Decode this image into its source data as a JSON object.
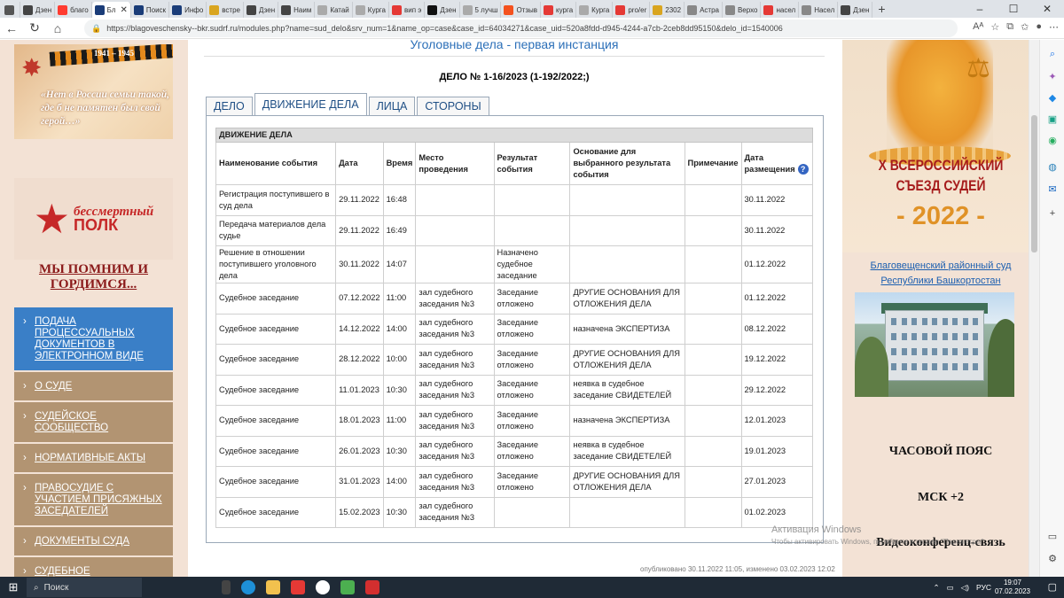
{
  "browser": {
    "tabs": [
      {
        "label": "",
        "color": "#555"
      },
      {
        "label": "Дзен",
        "color": "#444"
      },
      {
        "label": "благо",
        "color": "#ff3b30"
      },
      {
        "label": "Бл",
        "color": "#1a3c78",
        "active": true
      },
      {
        "label": "Поиск",
        "color": "#1a3c78"
      },
      {
        "label": "Инфо",
        "color": "#1a3c78"
      },
      {
        "label": "встре",
        "color": "#d9a520"
      },
      {
        "label": "Дзен",
        "color": "#444"
      },
      {
        "label": "Наим",
        "color": "#444"
      },
      {
        "label": "Катай",
        "color": "#aaa"
      },
      {
        "label": "Курга",
        "color": "#aaa"
      },
      {
        "label": "вип э",
        "color": "#e53935"
      },
      {
        "label": "Дзен",
        "color": "#111"
      },
      {
        "label": "5 лучш",
        "color": "#aaa"
      },
      {
        "label": "Отзыв",
        "color": "#f4511e"
      },
      {
        "label": "курга",
        "color": "#e53935"
      },
      {
        "label": "Курга",
        "color": "#aaa"
      },
      {
        "label": "pro/er",
        "color": "#e53935"
      },
      {
        "label": "2302",
        "color": "#d9a520"
      },
      {
        "label": "Астра",
        "color": "#888"
      },
      {
        "label": "Верхо",
        "color": "#888"
      },
      {
        "label": "насел",
        "color": "#e53935"
      },
      {
        "label": "Насел",
        "color": "#888"
      },
      {
        "label": "Дзен",
        "color": "#444"
      }
    ],
    "active_tab_close": "✕",
    "new_tab": "+",
    "url": "https://blagoveschensky--bkr.sudrf.ru/modules.php?name=sud_delo&srv_num=1&name_op=case&case_id=64034271&case_uid=520a8fdd-d945-4244-a7cb-2ceb8dd95150&delo_id=1540006",
    "zoom_label": "Aᴬ"
  },
  "left": {
    "banner1": {
      "years": "1941 – 1945",
      "quote": "«Нет в России семьи такой, где б не памятен был свой герой…»"
    },
    "banner2": {
      "line1": "бессмертный",
      "line2": "ПОЛК"
    },
    "memory_link": "МЫ ПОМНИМ И ГОРДИМСЯ...",
    "menu": [
      {
        "label": "ПОДАЧА ПРОЦЕССУАЛЬНЫХ ДОКУМЕНТОВ В ЭЛЕКТРОННОМ ВИДЕ",
        "active": true
      },
      {
        "label": "О СУДЕ"
      },
      {
        "label": "СУДЕЙСКОЕ СООБЩЕСТВО"
      },
      {
        "label": "НОРМАТИВНЫЕ АКТЫ"
      },
      {
        "label": "ПРАВОСУДИЕ С УЧАСТИЕМ ПРИСЯЖНЫХ ЗАСЕДАТЕЛЕЙ"
      },
      {
        "label": "ДОКУМЕНТЫ СУДА"
      },
      {
        "label": "СУДЕБНОЕ"
      }
    ]
  },
  "main": {
    "title": "Уголовные дела - первая инстанция",
    "case_number": "ДЕЛО № 1-16/2023 (1-192/2022;)",
    "tabs": [
      "ДЕЛО",
      "ДВИЖЕНИЕ ДЕЛА",
      "ЛИЦА",
      "СТОРОНЫ"
    ],
    "active_tab_index": 1,
    "table": {
      "caption": "ДВИЖЕНИЕ ДЕЛА",
      "headers": [
        "Наименование события",
        "Дата",
        "Время",
        "Место проведения",
        "Результат события",
        "Основание для выбранного результата события",
        "Примечание",
        "Дата размещения"
      ],
      "help_icon": "?",
      "rows": [
        [
          "Регистрация поступившего в суд дела",
          "29.11.2022",
          "16:48",
          "",
          "",
          "",
          "",
          "30.11.2022"
        ],
        [
          "Передача материалов дела судье",
          "29.11.2022",
          "16:49",
          "",
          "",
          "",
          "",
          "30.11.2022"
        ],
        [
          "Решение в отношении поступившего уголовного дела",
          "30.11.2022",
          "14:07",
          "",
          "Назначено судебное заседание",
          "",
          "",
          "01.12.2022"
        ],
        [
          "Судебное заседание",
          "07.12.2022",
          "11:00",
          "зал судебного заседания №3",
          "Заседание отложено",
          "ДРУГИЕ ОСНОВАНИЯ ДЛЯ ОТЛОЖЕНИЯ ДЕЛА",
          "",
          "01.12.2022"
        ],
        [
          "Судебное заседание",
          "14.12.2022",
          "14:00",
          "зал судебного заседания №3",
          "Заседание отложено",
          "назначена ЭКСПЕРТИЗА",
          "",
          "08.12.2022"
        ],
        [
          "Судебное заседание",
          "28.12.2022",
          "10:00",
          "зал судебного заседания №3",
          "Заседание отложено",
          "ДРУГИЕ ОСНОВАНИЯ ДЛЯ ОТЛОЖЕНИЯ ДЕЛА",
          "",
          "19.12.2022"
        ],
        [
          "Судебное заседание",
          "11.01.2023",
          "10:30",
          "зал судебного заседания №3",
          "Заседание отложено",
          "неявка в судебное заседание СВИДЕТЕЛЕЙ",
          "",
          "29.12.2022"
        ],
        [
          "Судебное заседание",
          "18.01.2023",
          "11:00",
          "зал судебного заседания №3",
          "Заседание отложено",
          "назначена ЭКСПЕРТИЗА",
          "",
          "12.01.2023"
        ],
        [
          "Судебное заседание",
          "26.01.2023",
          "10:30",
          "зал судебного заседания №3",
          "Заседание отложено",
          "неявка в судебное заседание СВИДЕТЕЛЕЙ",
          "",
          "19.01.2023"
        ],
        [
          "Судебное заседание",
          "31.01.2023",
          "14:00",
          "зал судебного заседания №3",
          "Заседание отложено",
          "ДРУГИЕ ОСНОВАНИЯ ДЛЯ ОТЛОЖЕНИЯ ДЕЛА",
          "",
          "27.01.2023"
        ],
        [
          "Судебное заседание",
          "15.02.2023",
          "10:30",
          "зал судебного заседания №3",
          "",
          "",
          "",
          "01.02.2023"
        ]
      ]
    },
    "published": "опубликовано 30.11.2022 11:05, изменено 03.02.2023 12:02"
  },
  "right": {
    "congress": "X ВСЕРОССИЙСКИЙ СЪЕЗД СУДЕЙ",
    "congress_year": "- 2022 -",
    "court_line1": "Благовещенский районный суд",
    "court_line2": "Республики Башкортостан",
    "timezone_title": "ЧАСОВОЙ ПОЯС",
    "timezone_value": "МСК +2",
    "video_link": "Видеоконференц-связь"
  },
  "os": {
    "activation_title": "Активация Windows",
    "activation_sub": "Чтобы активировать Windows, перейдите в раздел \"Параметры\".",
    "search_label": "Поиск",
    "lang": "РУС",
    "time": "19:07",
    "date": "07.02.2023"
  }
}
